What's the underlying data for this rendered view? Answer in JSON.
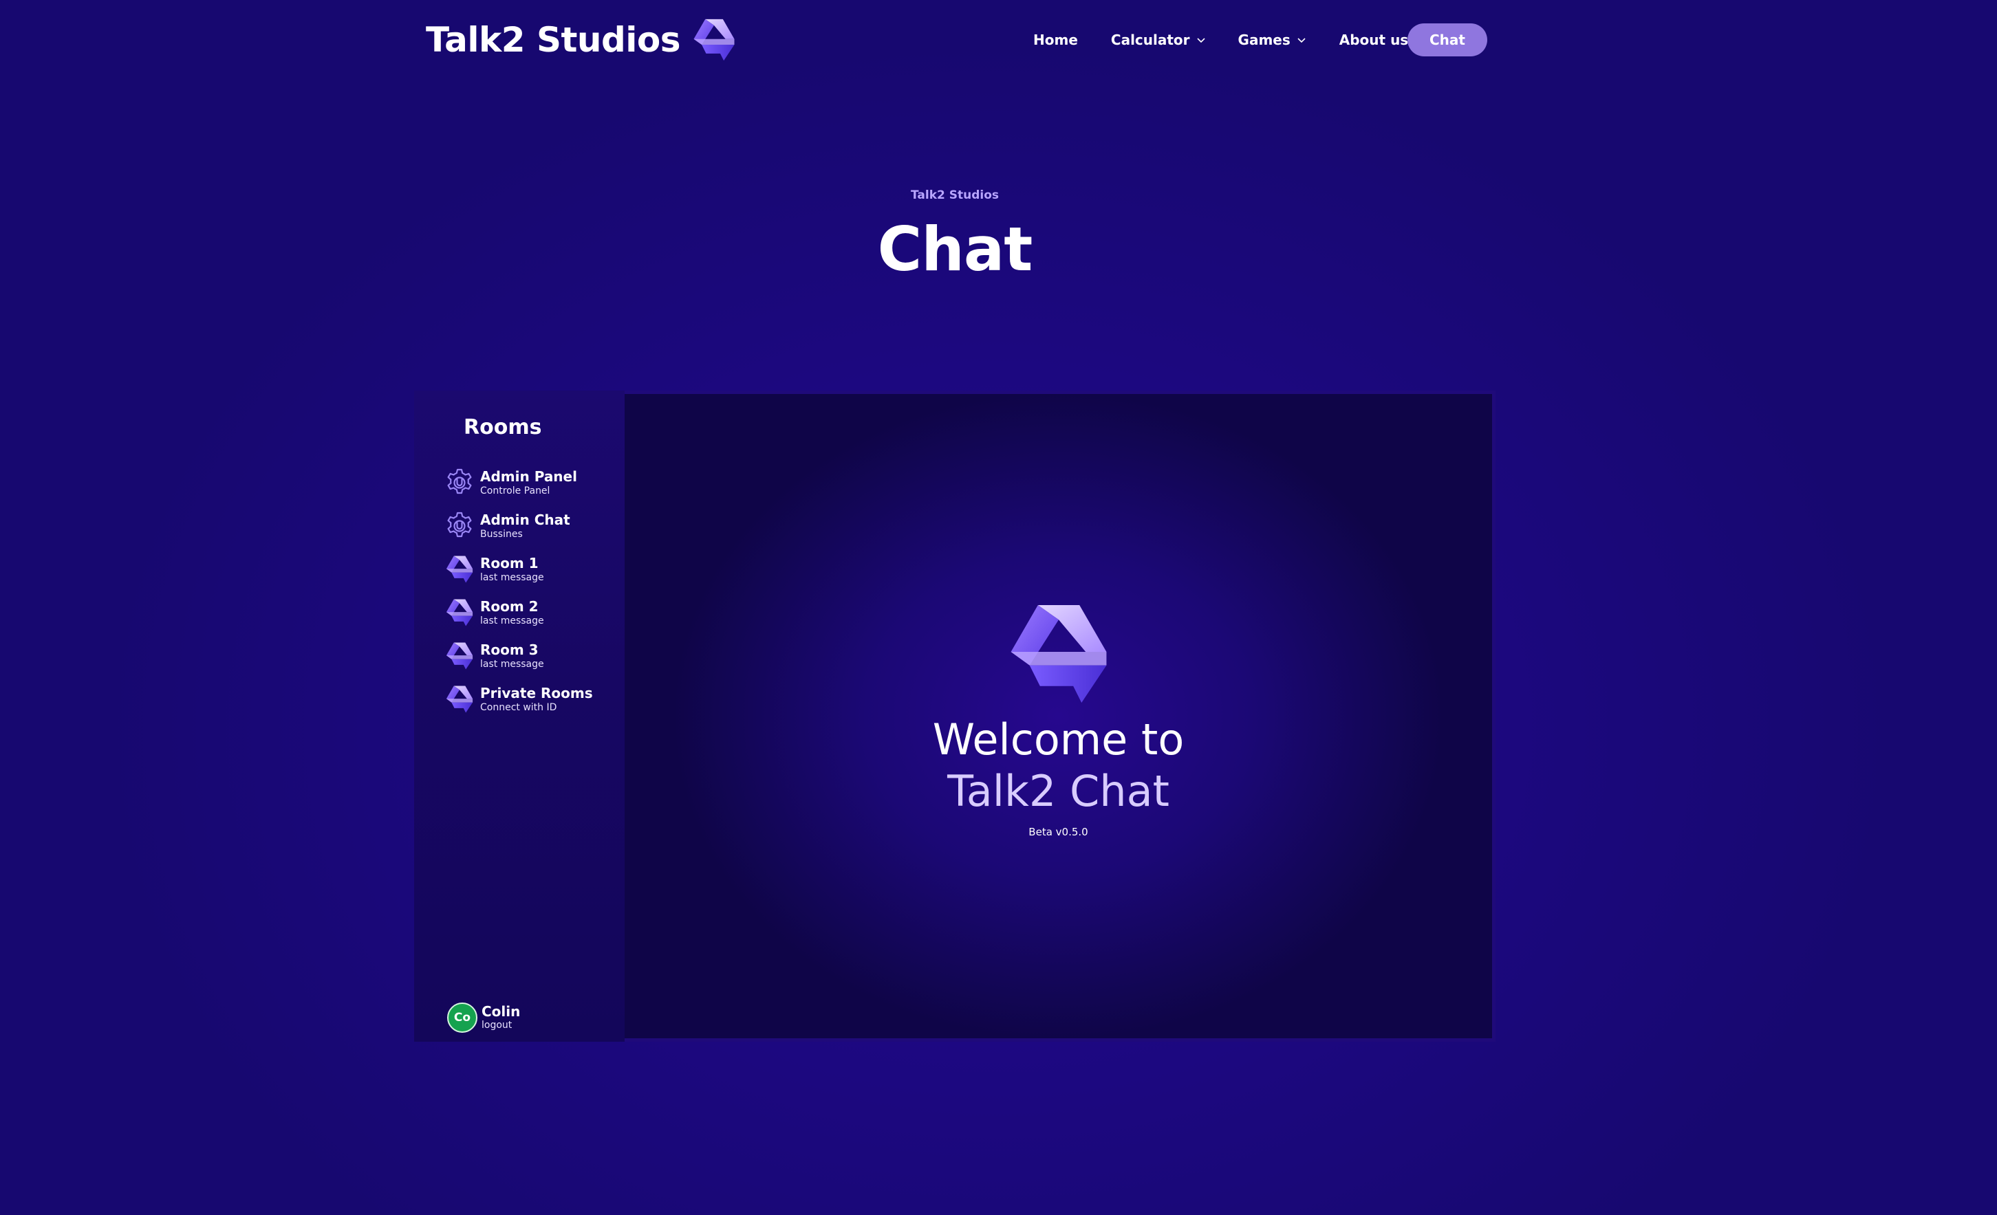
{
  "brand": {
    "name": "Talk2 Studios",
    "logo_icon": "talk2-logo-icon"
  },
  "nav": {
    "home": "Home",
    "calculator": "Calculator",
    "games": "Games",
    "about": "About us",
    "chat": "Chat"
  },
  "hero": {
    "eyebrow": "Talk2 Studios",
    "title": "Chat"
  },
  "sidebar": {
    "title": "Rooms",
    "rooms": [
      {
        "name": "Admin Panel",
        "sub": "Controle Panel",
        "icon": "gear-icon"
      },
      {
        "name": "Admin Chat",
        "sub": "Bussines",
        "icon": "gear-icon"
      },
      {
        "name": "Room 1",
        "sub": "last message",
        "icon": "talk2-logo-icon"
      },
      {
        "name": "Room 2",
        "sub": "last message",
        "icon": "talk2-logo-icon"
      },
      {
        "name": "Room 3",
        "sub": "last message",
        "icon": "talk2-logo-icon"
      },
      {
        "name": "Private Rooms",
        "sub": "Connect with ID",
        "icon": "talk2-logo-icon"
      }
    ],
    "user": {
      "initials": "Co",
      "name": "Colin",
      "action": "logout"
    }
  },
  "welcome": {
    "line1": "Welcome to",
    "line2": "Talk2 Chat",
    "version": "Beta v0.5.0"
  },
  "colors": {
    "background": "#1c087f",
    "accent": "#8f76df",
    "eyebrow": "#b8a5ff",
    "avatar": "#15a24f"
  }
}
